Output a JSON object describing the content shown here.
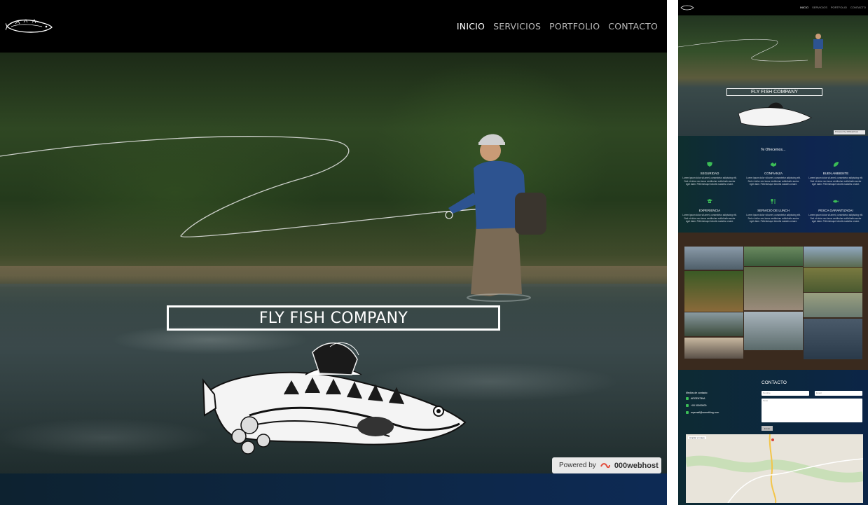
{
  "nav": {
    "logo_icon": "trout-logo-icon",
    "items": [
      {
        "label": "INICIO",
        "active": true
      },
      {
        "label": "SERVICIOS",
        "active": false
      },
      {
        "label": "PORTFOLIO",
        "active": false
      },
      {
        "label": "CONTACTO",
        "active": false
      }
    ]
  },
  "hero": {
    "title": "FLY FISH COMPANY",
    "emblem_icon": "trout-emblem-icon"
  },
  "powered": {
    "label": "Powered by",
    "brand": "000webhost"
  },
  "thumb": {
    "nav_items": [
      "INICIO",
      "SERVICIOS",
      "PORTFOLIO",
      "CONTACTO"
    ],
    "hero_title": "FLY FISH COMPANY",
    "powered": "Powered by 000webhost",
    "services": {
      "heading": "Te Ofrecemos...",
      "items": [
        {
          "name": "SEGURIDAD",
          "desc": "Lorem ipsum dolor sit amet, consectetur adipiscing elit. Sed et dolor nec lacus vestibulum sollicitudin auctor eget diam. Pellentesque lobortis sodales ornare."
        },
        {
          "name": "CONFIANZA",
          "desc": "Lorem ipsum dolor sit amet, consectetur adipiscing elit. Sed et dolor nec lacus vestibulum sollicitudin auctor eget diam. Pellentesque lobortis sodales ornare."
        },
        {
          "name": "BUEN AMBIENTE",
          "desc": "Lorem ipsum dolor sit amet, consectetur adipiscing elit. Sed et dolor nec lacus vestibulum sollicitudin auctor eget diam. Pellentesque lobortis sodales ornare."
        },
        {
          "name": "EXPERIENCIA",
          "desc": "Lorem ipsum dolor sit amet, consectetur adipiscing elit. Sed et dolor nec lacus vestibulum sollicitudin auctor eget diam. Pellentesque lobortis sodales ornare."
        },
        {
          "name": "SERVICIO DE LUNCH",
          "desc": "Lorem ipsum dolor sit amet, consectetur adipiscing elit. Sed et dolor nec lacus vestibulum sollicitudin auctor eget diam. Pellentesque lobortis sodales ornare."
        },
        {
          "name": "PESCA GARANTIZADA!",
          "desc": "Lorem ipsum dolor sit amet, consectetur adipiscing elit. Sed et dolor nec lacus vestibulum sollicitudin auctor eget diam. Pellentesque lobortis sodales ornare."
        }
      ]
    },
    "contact": {
      "title": "CONTACTO",
      "label": "Medios de contacto:",
      "country": "ARGENTINA",
      "phone": "+00 00000000",
      "email": "myemail@something.com",
      "name_placeholder": "Nombre",
      "email_placeholder": "Email",
      "message_placeholder": "Texto",
      "send_label": "Enviar",
      "map_label": "Ampliar el mapa"
    }
  },
  "colors": {
    "nav_bg": "#000000",
    "accent_green": "#3bbd56",
    "services_bg": "#0e2550",
    "portfolio_bg": "#3a2a1e"
  }
}
